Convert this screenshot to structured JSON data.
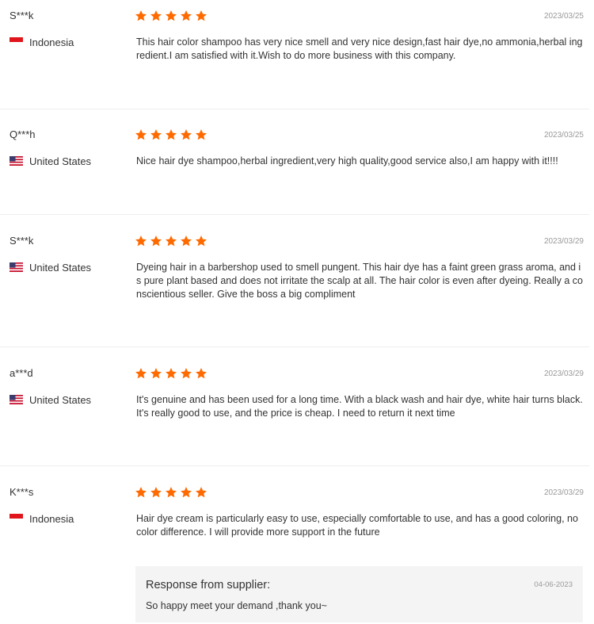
{
  "colors": {
    "star": "#ff6a00",
    "divider": "#eeeeee",
    "date": "#999999",
    "supplier_bg": "#f4f4f4"
  },
  "reviews": [
    {
      "user": "S***k",
      "country": "Indonesia",
      "flag": "indonesia-flag-icon",
      "rating": 5,
      "date": "2023/03/25",
      "text": "This hair color shampoo has very nice smell and very nice design,fast hair dye,no ammonia,herbal ingredient.I am satisfied with it.Wish to do more business with this company."
    },
    {
      "user": "Q***h",
      "country": "United States",
      "flag": "us-flag-icon",
      "rating": 5,
      "date": "2023/03/25",
      "text": "Nice hair dye shampoo,herbal ingredient,very high quality,good service also,I am happy with it!!!!"
    },
    {
      "user": "S***k",
      "country": "United States",
      "flag": "us-flag-icon",
      "rating": 5,
      "date": "2023/03/29",
      "text": "Dyeing hair in a barbershop used to smell pungent. This hair dye has a faint green grass aroma, and is pure plant based and does not irritate the scalp at all. The hair color is even after dyeing. Really a conscientious seller. Give the boss a big compliment"
    },
    {
      "user": "a***d",
      "country": "United States",
      "flag": "us-flag-icon",
      "rating": 5,
      "date": "2023/03/29",
      "text": "It's genuine and has been used for a long time. With a black wash and hair dye, white hair turns black. It's really good to use, and the price is cheap. I need to return it next time"
    },
    {
      "user": "K***s",
      "country": "Indonesia",
      "flag": "indonesia-flag-icon",
      "rating": 5,
      "date": "2023/03/29",
      "text": "Hair dye cream is particularly easy to use, especially comfortable to use, and has a good coloring, no color difference. I will provide more support in the future"
    }
  ],
  "supplier_response": {
    "title": "Response from supplier:",
    "date": "04-06-2023",
    "text": "So happy meet your demand ,thank you~"
  }
}
